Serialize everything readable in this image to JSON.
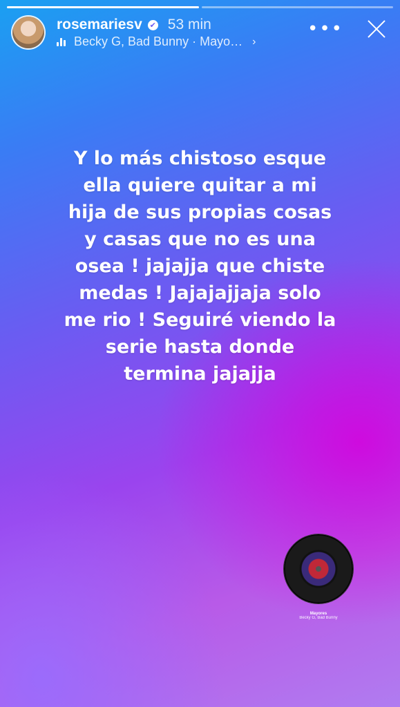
{
  "story": {
    "progress_segments": [
      true,
      false
    ],
    "username": "rosemariesv",
    "verified_symbol": "✔",
    "time_ago": "53 min",
    "music_text": "Becky G, Bad Bunny · Mayo…",
    "more_symbol": "•••",
    "caption": "Y lo más chistoso esque\nella quiere quitar a mi\nhija de sus propias cosas\ny casas que no es una\nosea !  jajajja que chiste\nmedas ! Jajajajjaja solo\nme rio ! Seguiré viendo la\nserie hasta donde\ntermina jajajja"
  },
  "sticker": {
    "title": "Mayores",
    "artist": "Becky G, Bad Bunny"
  },
  "icons": [
    "avatar",
    "verified-icon",
    "audio-bars-icon",
    "chevron-right-icon",
    "more-icon",
    "close-icon",
    "music-disc-icon"
  ]
}
